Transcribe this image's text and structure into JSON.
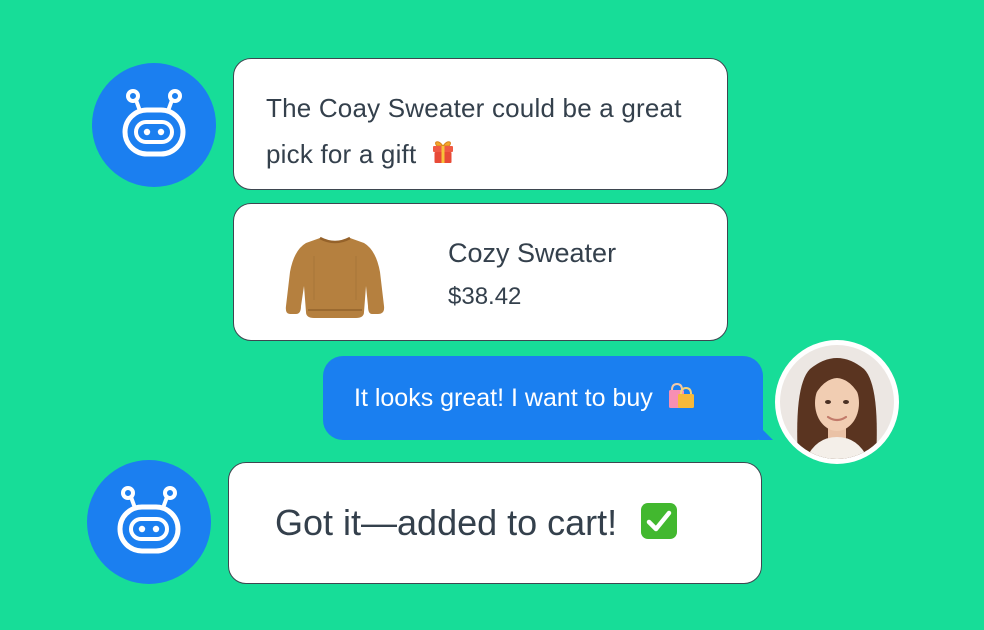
{
  "messages": {
    "bot_message_1": "The Coay Sweater could be a great pick for a gift",
    "product": {
      "name": "Cozy Sweater",
      "price": "$38.42"
    },
    "user_message": "It looks great! I want to buy",
    "bot_message_2": "Got it—added to cart!"
  },
  "icons": {
    "bot_avatar": "robot-icon",
    "gift": "gift-icon",
    "shopping_bags": "shopping-bags-icon",
    "check": "checkmark-icon",
    "sweater": "sweater-icon",
    "user_avatar": "user-avatar"
  },
  "colors": {
    "background": "#17dd98",
    "bot_avatar": "#1b7ff0",
    "user_bubble": "#1a7ff0",
    "bubble": "#ffffff",
    "text": "#34404c"
  }
}
